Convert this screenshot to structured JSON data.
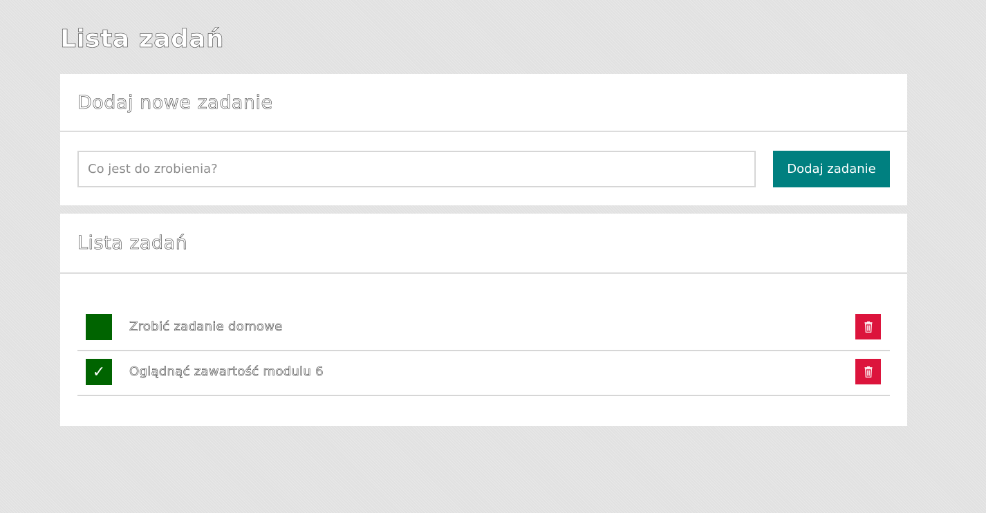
{
  "page": {
    "title": "Lista zadań"
  },
  "add_card": {
    "title": "Dodaj nowe zadanie",
    "input_placeholder": "Co jest do zrobienia?",
    "input_value": "",
    "button_label": "Dodaj zadanie"
  },
  "list_card": {
    "title": "Lista zadań",
    "tasks": [
      {
        "text": "Zrobić zadanie domowe",
        "done": false,
        "check_mark": "",
        "delete_icon": "trash-icon"
      },
      {
        "text": "Oglądnąć zawartość modulu 6",
        "done": true,
        "check_mark": "✓",
        "delete_icon": "trash-icon"
      }
    ]
  },
  "colors": {
    "background": "#e1e1e1",
    "card": "#ffffff",
    "accent": "#008080",
    "checkbox": "#006400",
    "delete": "#dc143c"
  }
}
